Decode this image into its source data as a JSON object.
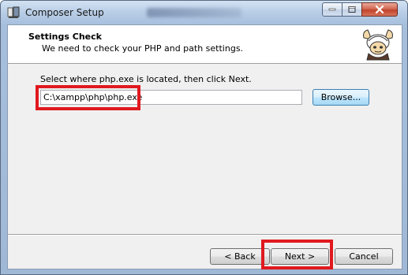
{
  "window": {
    "title": "Composer Setup",
    "icon": "composer-setup-icon"
  },
  "header": {
    "title": "Settings Check",
    "subtitle": "We need to check your PHP and path settings.",
    "logo": "composer-logo"
  },
  "main": {
    "instruction": "Select where php.exe is located, then click Next.",
    "php_path_value": "C:\\xampp\\php\\php.exe",
    "browse_label": "Browse..."
  },
  "footer": {
    "back_label": "< Back",
    "next_label": "Next >",
    "cancel_label": "Cancel"
  },
  "colors": {
    "highlight": "#e0191f",
    "titlebar": "#b8cde6",
    "close_button": "#c2432b"
  }
}
